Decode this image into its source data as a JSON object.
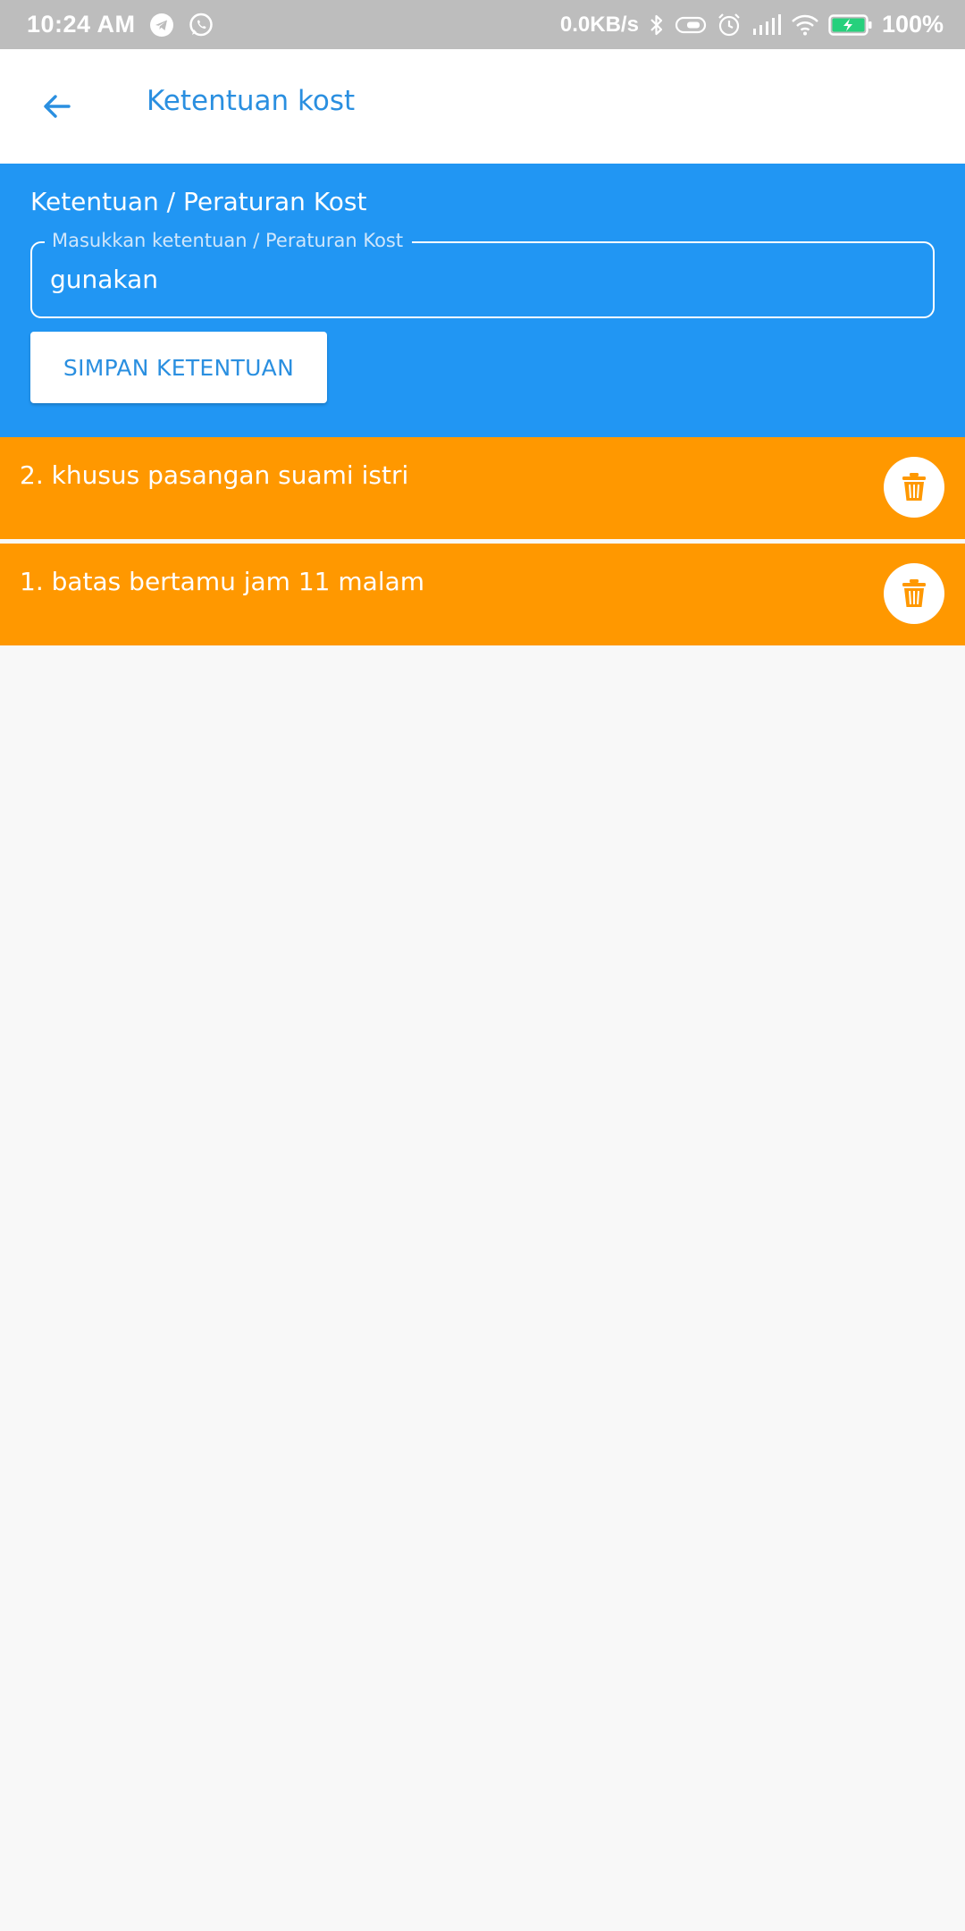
{
  "status_bar": {
    "time": "10:24 AM",
    "network_speed": "0.0KB/s",
    "battery_percent": "100%",
    "left_icons": [
      "telegram-icon",
      "whatsapp-icon"
    ],
    "right_icons": [
      "bluetooth-icon",
      "toggle-icon",
      "alarm-icon",
      "signal-icon",
      "wifi-icon",
      "battery-charging-icon"
    ]
  },
  "app_bar": {
    "title": "Ketentuan kost",
    "back_icon": "arrow-left-icon"
  },
  "form": {
    "heading": "Ketentuan / Peraturan Kost",
    "field_label": "Masukkan ketentuan / Peraturan Kost",
    "field_value": "gunakan",
    "save_label": "SIMPAN KETENTUAN"
  },
  "rules": [
    {
      "text": "2. khusus pasangan suami istri",
      "action_icon": "trash-icon"
    },
    {
      "text": "1. batas bertamu jam 11 malam",
      "action_icon": "trash-icon"
    }
  ],
  "colors": {
    "status_bar": "#bdbdbd",
    "primary": "#2196f3",
    "title_text": "#2a8fe0",
    "rule_background": "#ff9800",
    "page_background": "#f8f8f8"
  }
}
